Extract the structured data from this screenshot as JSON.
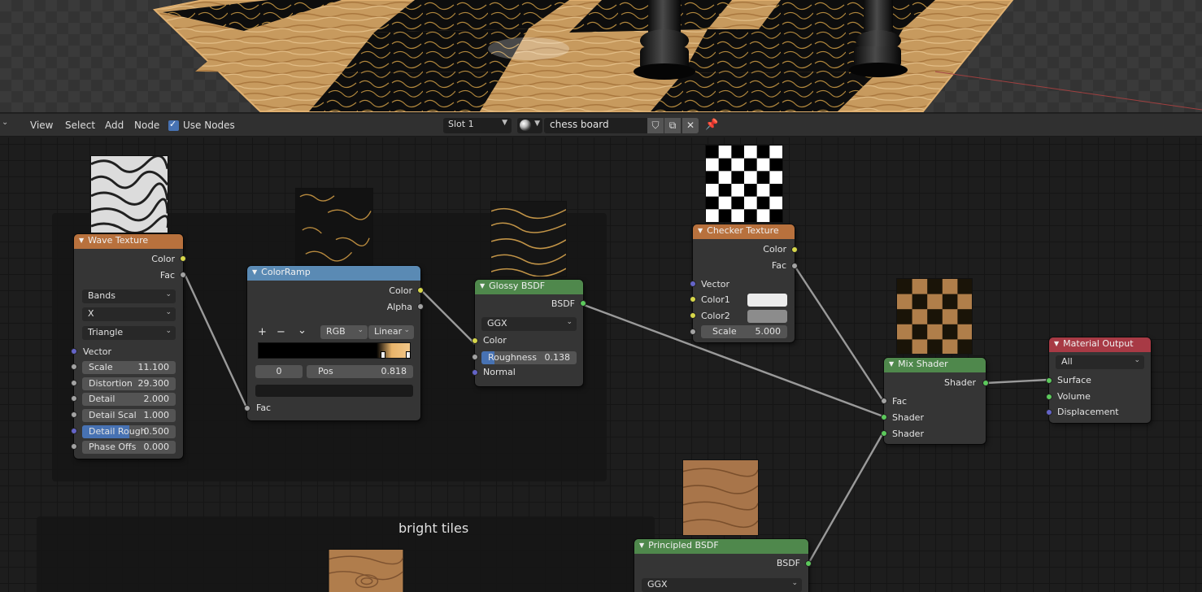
{
  "header": {
    "menus": [
      "View",
      "Select",
      "Add",
      "Node"
    ],
    "use_nodes_label": "Use Nodes",
    "slot": "Slot 1",
    "material_name": "chess board"
  },
  "frames": {
    "bright_tiles_label": "bright tiles"
  },
  "nodes": {
    "wave_texture": {
      "title": "Wave Texture",
      "outputs": [
        "Color",
        "Fac"
      ],
      "type_dropdown": "Bands",
      "direction_dropdown": "X",
      "profile_dropdown": "Triangle",
      "vector_label": "Vector",
      "fields": [
        {
          "label": "Scale",
          "value": "11.100"
        },
        {
          "label": "Distortion",
          "value": "29.300"
        },
        {
          "label": "Detail",
          "value": "2.000"
        },
        {
          "label": "Detail Scal",
          "value": "1.000"
        },
        {
          "label": "Detail Rough",
          "value": "0.500"
        },
        {
          "label": "Phase Offs",
          "value": "0.000"
        }
      ]
    },
    "color_ramp": {
      "title": "ColorRamp",
      "outputs": [
        "Color",
        "Alpha"
      ],
      "buttons": [
        "+",
        "−",
        "⌄"
      ],
      "color_mode": "RGB",
      "interpolation": "Linear",
      "stop_index": "0",
      "pos_label": "Pos",
      "pos_value": "0.818",
      "input_label": "Fac"
    },
    "glossy_bsdf": {
      "title": "Glossy BSDF",
      "output": "BSDF",
      "distribution": "GGX",
      "inputs": [
        "Color",
        "Normal"
      ],
      "roughness_label": "Roughness",
      "roughness_value": "0.138",
      "roughness_fraction": 0.138
    },
    "checker_texture": {
      "title": "Checker Texture",
      "outputs": [
        "Color",
        "Fac"
      ],
      "inputs": [
        "Vector",
        "Color1",
        "Color2"
      ],
      "scale_label": "Scale",
      "scale_value": "5.000",
      "color1": "#ececec",
      "color2": "#8c8c8c"
    },
    "mix_shader": {
      "title": "Mix Shader",
      "output": "Shader",
      "inputs": [
        "Fac",
        "Shader",
        "Shader"
      ]
    },
    "material_output": {
      "title": "Material Output",
      "target": "All",
      "inputs": [
        "Surface",
        "Volume",
        "Displacement"
      ]
    },
    "principled_bsdf": {
      "title": "Principled BSDF",
      "output": "BSDF",
      "distribution": "GGX"
    }
  },
  "colors": {
    "texture_header": "#b8713d",
    "converter_header": "#5a8ab4",
    "shader_header": "#4f884c",
    "output_header": "#a83a45",
    "socket_color": "#d7d74a",
    "socket_float": "#a3a3a3",
    "socket_vector": "#6464c8",
    "socket_shader": "#5cc95c",
    "selection": "#4772b3"
  }
}
